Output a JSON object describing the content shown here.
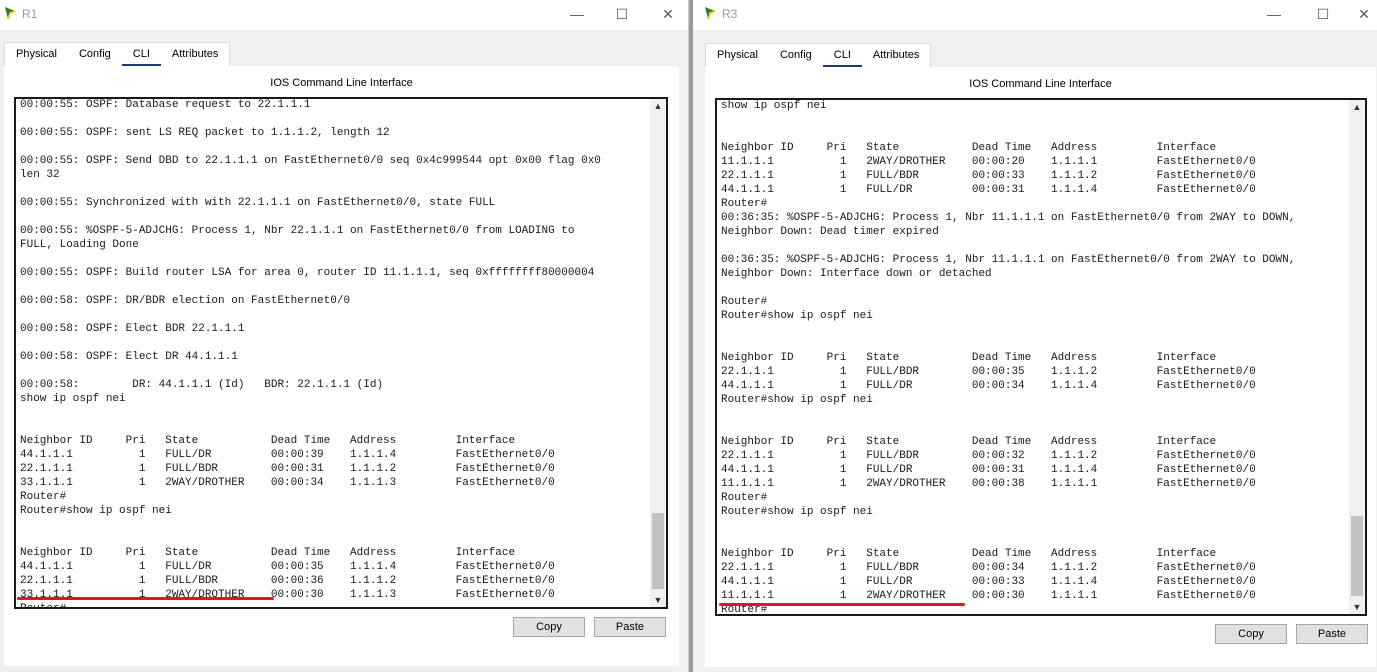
{
  "windows": [
    {
      "title": "R1",
      "tabs": [
        "Physical",
        "Config",
        "CLI",
        "Attributes"
      ],
      "active_tab": "CLI",
      "panel_title": "IOS Command Line Interface",
      "copy_label": "Copy",
      "paste_label": "Paste",
      "console_lines": [
        "00:00:55: OSPF: Database request to 22.1.1.1",
        "",
        "00:00:55: OSPF: sent LS REQ packet to 1.1.1.2, length 12",
        "",
        "00:00:55: OSPF: Send DBD to 22.1.1.1 on FastEthernet0/0 seq 0x4c999544 opt 0x00 flag 0x0",
        "len 32",
        "",
        "00:00:55: Synchronized with with 22.1.1.1 on FastEthernet0/0, state FULL",
        "",
        "00:00:55: %OSPF-5-ADJCHG: Process 1, Nbr 22.1.1.1 on FastEthernet0/0 from LOADING to",
        "FULL, Loading Done",
        "",
        "00:00:55: OSPF: Build router LSA for area 0, router ID 11.1.1.1, seq 0xffffffff80000004",
        "",
        "00:00:58: OSPF: DR/BDR election on FastEthernet0/0",
        "",
        "00:00:58: OSPF: Elect BDR 22.1.1.1",
        "",
        "00:00:58: OSPF: Elect DR 44.1.1.1",
        "",
        "00:00:58:        DR: 44.1.1.1 (Id)   BDR: 22.1.1.1 (Id)",
        "show ip ospf nei",
        "",
        "",
        "Neighbor ID     Pri   State           Dead Time   Address         Interface",
        "44.1.1.1          1   FULL/DR         00:00:39    1.1.1.4         FastEthernet0/0",
        "22.1.1.1          1   FULL/BDR        00:00:31    1.1.1.2         FastEthernet0/0",
        "33.1.1.1          1   2WAY/DROTHER    00:00:34    1.1.1.3         FastEthernet0/0",
        "Router#",
        "Router#show ip ospf nei",
        "",
        "",
        "Neighbor ID     Pri   State           Dead Time   Address         Interface",
        "44.1.1.1          1   FULL/DR         00:00:35    1.1.1.4         FastEthernet0/0",
        "22.1.1.1          1   FULL/BDR        00:00:36    1.1.1.2         FastEthernet0/0",
        "33.1.1.1          1   2WAY/DROTHER    00:00:30    1.1.1.3         FastEthernet0/0",
        "Router#"
      ]
    },
    {
      "title": "R3",
      "tabs": [
        "Physical",
        "Config",
        "CLI",
        "Attributes"
      ],
      "active_tab": "CLI",
      "panel_title": "IOS Command Line Interface",
      "copy_label": "Copy",
      "paste_label": "Paste",
      "console_lines": [
        "show ip ospf nei",
        "",
        "",
        "Neighbor ID     Pri   State           Dead Time   Address         Interface",
        "11.1.1.1          1   2WAY/DROTHER    00:00:20    1.1.1.1         FastEthernet0/0",
        "22.1.1.1          1   FULL/BDR        00:00:33    1.1.1.2         FastEthernet0/0",
        "44.1.1.1          1   FULL/DR         00:00:31    1.1.1.4         FastEthernet0/0",
        "Router#",
        "00:36:35: %OSPF-5-ADJCHG: Process 1, Nbr 11.1.1.1 on FastEthernet0/0 from 2WAY to DOWN,",
        "Neighbor Down: Dead timer expired",
        "",
        "00:36:35: %OSPF-5-ADJCHG: Process 1, Nbr 11.1.1.1 on FastEthernet0/0 from 2WAY to DOWN,",
        "Neighbor Down: Interface down or detached",
        "",
        "Router#",
        "Router#show ip ospf nei",
        "",
        "",
        "Neighbor ID     Pri   State           Dead Time   Address         Interface",
        "22.1.1.1          1   FULL/BDR        00:00:35    1.1.1.2         FastEthernet0/0",
        "44.1.1.1          1   FULL/DR         00:00:34    1.1.1.4         FastEthernet0/0",
        "Router#show ip ospf nei",
        "",
        "",
        "Neighbor ID     Pri   State           Dead Time   Address         Interface",
        "22.1.1.1          1   FULL/BDR        00:00:32    1.1.1.2         FastEthernet0/0",
        "44.1.1.1          1   FULL/DR         00:00:31    1.1.1.4         FastEthernet0/0",
        "11.1.1.1          1   2WAY/DROTHER    00:00:38    1.1.1.1         FastEthernet0/0",
        "Router#",
        "Router#show ip ospf nei",
        "",
        "",
        "Neighbor ID     Pri   State           Dead Time   Address         Interface",
        "22.1.1.1          1   FULL/BDR        00:00:34    1.1.1.2         FastEthernet0/0",
        "44.1.1.1          1   FULL/DR         00:00:33    1.1.1.4         FastEthernet0/0",
        "11.1.1.1          1   2WAY/DROTHER    00:00:30    1.1.1.1         FastEthernet0/0",
        "Router#"
      ]
    }
  ],
  "icons": {
    "minimize": "minimize-icon",
    "maximize": "maximize-icon",
    "close": "close-icon",
    "app": "packet-tracer-router-icon"
  },
  "colors": {
    "highlight_underline": "#e3151f",
    "active_tab_indicator": "#1f3a6e"
  }
}
